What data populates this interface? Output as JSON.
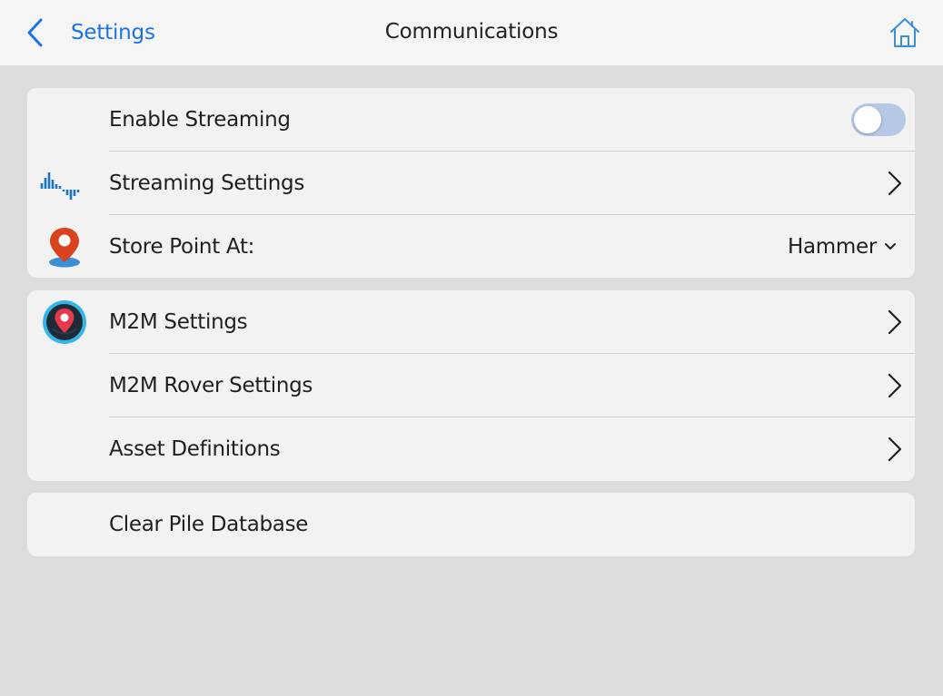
{
  "header": {
    "back_label": "Settings",
    "title": "Communications",
    "back_icon": "chevron-left-icon",
    "home_icon": "home-icon"
  },
  "groups": [
    {
      "rows": [
        {
          "label": "Enable Streaming",
          "accessory": "toggle",
          "toggle_on": false
        },
        {
          "label": "Streaming Settings",
          "icon": "streaming-waveform-icon",
          "accessory": "chevron-right-icon"
        },
        {
          "label": "Store Point At:",
          "icon": "map-pin-icon",
          "accessory": "select",
          "value": "Hammer"
        }
      ]
    },
    {
      "rows": [
        {
          "label": "M2M Settings",
          "icon": "m2m-location-icon",
          "accessory": "chevron-right-icon"
        },
        {
          "label": "M2M Rover Settings",
          "accessory": "chevron-right-icon"
        },
        {
          "label": "Asset Definitions",
          "accessory": "chevron-right-icon"
        }
      ]
    },
    {
      "rows": [
        {
          "label": "Clear Pile Database"
        }
      ]
    }
  ],
  "colors": {
    "accent": "#1a73e8",
    "background": "#dcdcdc",
    "card": "#f2f2f2",
    "navbar": "#f5f5f5",
    "toggle_off_track": "#b5c8e6",
    "pin_orange": "#d8431e",
    "waveform_blue": "#1a73c8"
  }
}
